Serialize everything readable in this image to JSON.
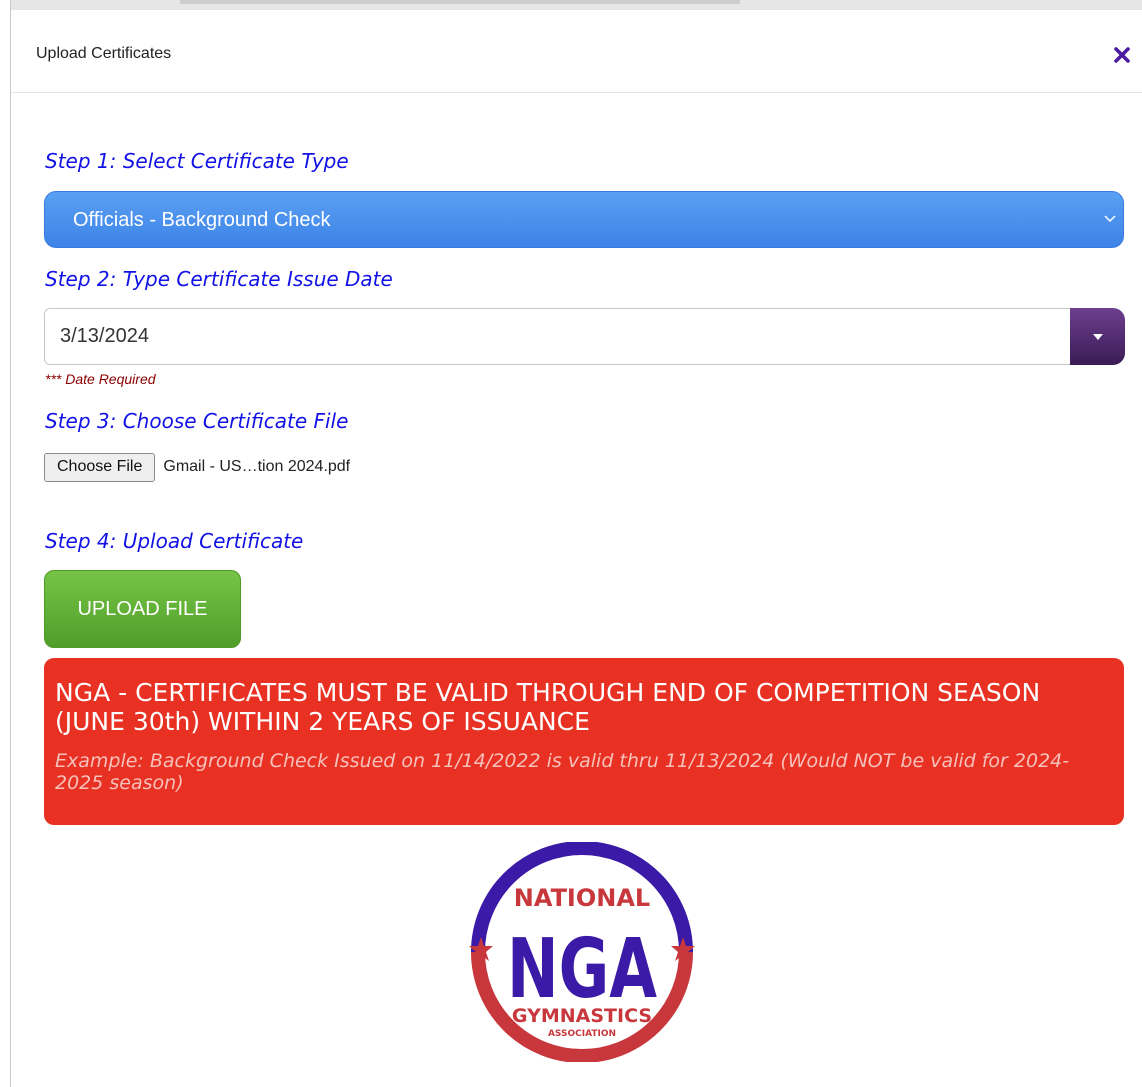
{
  "modal": {
    "title": "Upload Certificates",
    "close_icon": "close-icon",
    "accent_color": "#4b1ba0"
  },
  "step1": {
    "label": "Step 1: Select Certificate Type",
    "selected_value": "Officials - Background Check",
    "color": "#3d83e8"
  },
  "step2": {
    "label": "Step 2: Type Certificate Issue Date",
    "date_value": "3/13/2024",
    "required_text": "*** Date Required"
  },
  "step3": {
    "label": "Step 3: Choose Certificate File",
    "button_label": "Choose File",
    "file_name": "Gmail - US…tion 2024.pdf"
  },
  "step4": {
    "label": "Step 4: Upload Certificate",
    "button_label": "UPLOAD FILE",
    "color": "#5faa33"
  },
  "notice": {
    "title": "NGA - CERTIFICATES MUST BE VALID THROUGH END OF COMPETITION SEASON (JUNE 30th) WITHIN 2 YEARS OF ISSUANCE",
    "example": "Example: Background Check Issued on 11/14/2022 is valid thru 11/13/2024 (Would NOT be valid for 2024-2025 season)",
    "color": "#e83123"
  },
  "logo": {
    "top_text": "NATIONAL",
    "main_text": "NGA",
    "bottom_text": "GYMNASTICS",
    "sub_text": "ASSOCIATION"
  }
}
